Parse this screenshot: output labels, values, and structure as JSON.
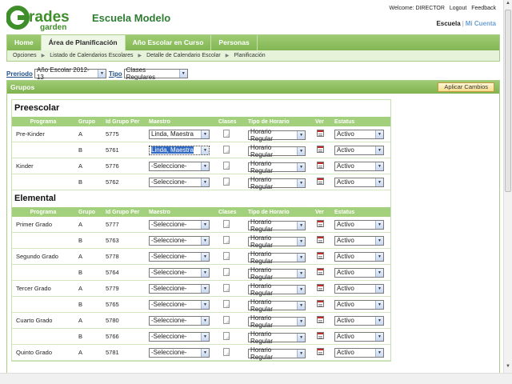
{
  "header": {
    "logo_text": "Grades garden",
    "school": "Escuela Modelo",
    "welcome": "Welcome: DIRECTOR",
    "logout": "Logout",
    "feedback": "Feedback",
    "school_link": "Escuela",
    "account_link": "Mi Cuenta"
  },
  "nav": {
    "tabs": [
      {
        "label": "Home"
      },
      {
        "label": "Área de Planificación"
      },
      {
        "label": "Año Escolar en Curso"
      },
      {
        "label": "Personas"
      }
    ],
    "breadcrumbs": [
      "Opciones",
      "Listado de Calendarios Escolares",
      "Detalle de Calendario Escolar",
      "Planificación"
    ]
  },
  "filters": {
    "periodo_label": "Preriodo",
    "periodo_value": "Año Escolar 2012-13",
    "tipo_label": "Tipo",
    "tipo_value": "Clases Regulares"
  },
  "panel": {
    "title": "Grupos",
    "apply_button": "Aplicar Cambios"
  },
  "columns": {
    "programa": "Programa",
    "grupo": "Grupo",
    "id": "Id Grupo Per",
    "maestro": "Maestro",
    "clases": "Clases",
    "tipo": "Tipo de Horario",
    "ver": "Ver",
    "estatus": "Estatus"
  },
  "sections": [
    {
      "title": "Preescolar",
      "rows": [
        {
          "programa": "Pre-Kinder",
          "grupo": "A",
          "id": "5775",
          "maestro": "Linda, Maestra",
          "tipo": "Horario Regular",
          "estatus": "Activo"
        },
        {
          "programa": "",
          "grupo": "B",
          "id": "5761",
          "maestro": "Linda, Maestra",
          "tipo": "Horario Regular",
          "estatus": "Activo"
        },
        {
          "programa": "Kinder",
          "grupo": "A",
          "id": "5776",
          "maestro": "-Seleccione-",
          "tipo": "Horario Regular",
          "estatus": "Activo"
        },
        {
          "programa": "",
          "grupo": "B",
          "id": "5762",
          "maestro": "-Seleccione-",
          "tipo": "Horario Regular",
          "estatus": "Activo"
        }
      ]
    },
    {
      "title": "Elemental",
      "rows": [
        {
          "programa": "Primer Grado",
          "grupo": "A",
          "id": "5777",
          "maestro": "-Seleccione-",
          "tipo": "Horario Regular",
          "estatus": "Activo"
        },
        {
          "programa": "",
          "grupo": "B",
          "id": "5763",
          "maestro": "-Seleccione-",
          "tipo": "Horario Regular",
          "estatus": "Activo"
        },
        {
          "programa": "Segundo Grado",
          "grupo": "A",
          "id": "5778",
          "maestro": "-Seleccione-",
          "tipo": "Horario Regular",
          "estatus": "Activo"
        },
        {
          "programa": "",
          "grupo": "B",
          "id": "5764",
          "maestro": "-Seleccione-",
          "tipo": "Horario Regular",
          "estatus": "Activo"
        },
        {
          "programa": "Tercer Grado",
          "grupo": "A",
          "id": "5779",
          "maestro": "-Seleccione-",
          "tipo": "Horario Regular",
          "estatus": "Activo"
        },
        {
          "programa": "",
          "grupo": "B",
          "id": "5765",
          "maestro": "-Seleccione-",
          "tipo": "Horario Regular",
          "estatus": "Activo"
        },
        {
          "programa": "Cuarto Grado",
          "grupo": "A",
          "id": "5780",
          "maestro": "-Seleccione-",
          "tipo": "Horario Regular",
          "estatus": "Activo"
        },
        {
          "programa": "",
          "grupo": "B",
          "id": "5766",
          "maestro": "-Seleccione-",
          "tipo": "Horario Regular",
          "estatus": "Activo"
        },
        {
          "programa": "Quinto Grado",
          "grupo": "A",
          "id": "5781",
          "maestro": "-Seleccione-",
          "tipo": "Horario Regular",
          "estatus": "Activo"
        }
      ]
    }
  ],
  "colors": {
    "nav_green": "#8cbf60",
    "header_row_green": "#a3d07c",
    "title_green": "#2e7d32",
    "apply_bg": "#f6dc8c"
  }
}
